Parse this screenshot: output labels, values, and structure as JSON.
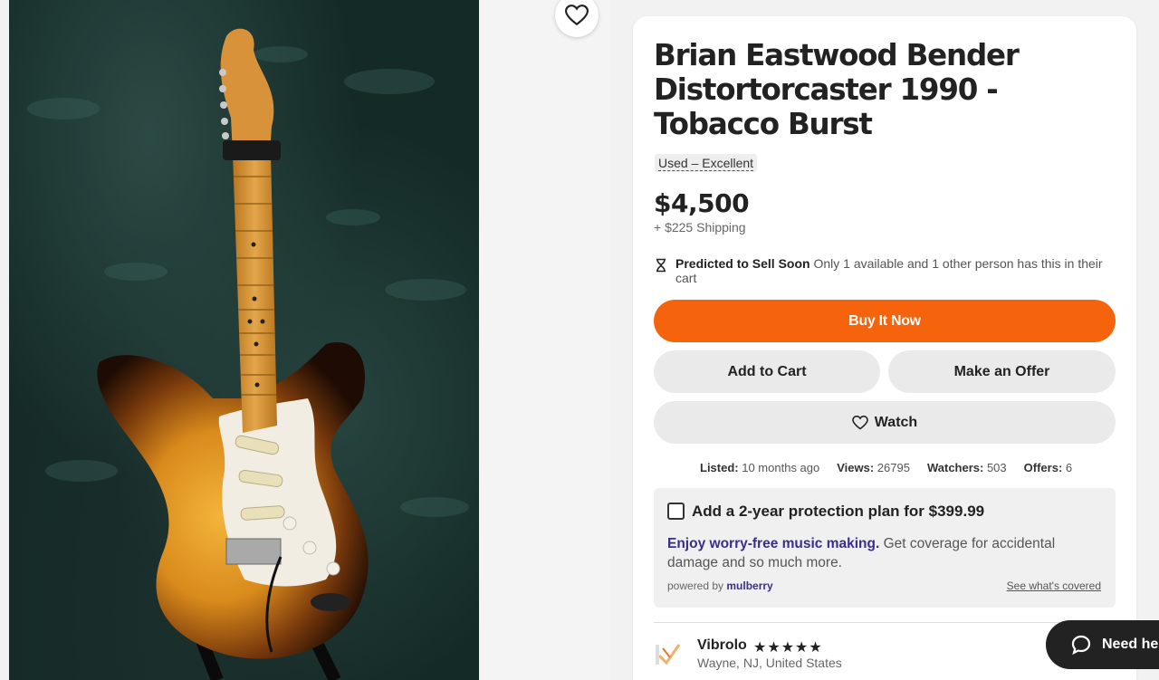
{
  "listing": {
    "title": "Brian Eastwood Bender Distortorcaster 1990 - Tobacco Burst",
    "condition": "Used – Excellent",
    "price": "$4,500",
    "shipping": "+ $225 Shipping",
    "predict_label": "Predicted to Sell Soon",
    "predict_text": " Only 1 available and 1 other person has this in their cart"
  },
  "actions": {
    "buy_now": "Buy It Now",
    "add_to_cart": "Add to Cart",
    "make_offer": "Make an Offer",
    "watch": "Watch"
  },
  "stats": {
    "listed_label": "Listed:",
    "listed_value": " 10 months ago",
    "views_label": "Views:",
    "views_value": " 26795",
    "watchers_label": "Watchers:",
    "watchers_value": " 503",
    "offers_label": "Offers:",
    "offers_value": " 6"
  },
  "protection": {
    "title": "Add a 2-year protection plan for $399.99",
    "highlight": "Enjoy worry-free music making.",
    "desc": " Get coverage for accidental damage and so much more.",
    "powered_by": "powered by ",
    "provider": "mulberry",
    "covered_link": "See what's covered"
  },
  "seller": {
    "name": "Vibrolo",
    "stars": "★★★★★",
    "location": "Wayne, NJ, United States"
  },
  "help": {
    "label": "Need hel"
  },
  "colors": {
    "accent": "#f5630c",
    "mulberry": "#3a2e8c",
    "button_bg": "#eaeaea"
  },
  "icons": [
    "heart-icon",
    "hourglass-icon",
    "chat-icon",
    "star-icon"
  ]
}
